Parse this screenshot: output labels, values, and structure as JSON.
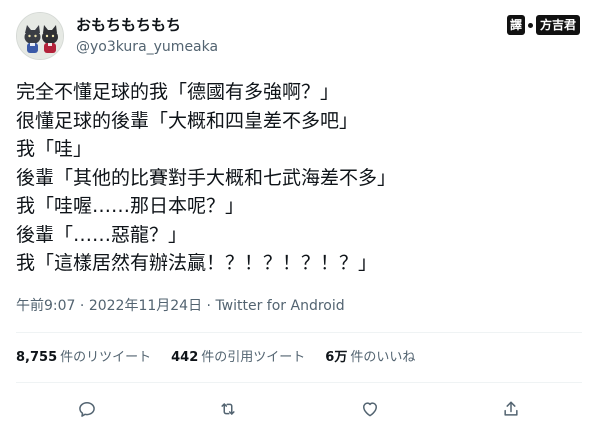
{
  "user": {
    "display_name": "おもちもちもち",
    "handle": "@yo3kura_yumeaka",
    "avatar_icon": "cat-avatar-icon"
  },
  "translator": {
    "label": "譯",
    "name": "方吉君"
  },
  "tweet": {
    "lines": [
      "完全不懂足球的我「德國有多強啊？」",
      "很懂足球的後輩「大概和四皇差不多吧」",
      "我「哇」",
      "後輩「其他的比賽對手大概和七武海差不多」",
      "我「哇喔……那日本呢？」",
      "後輩「……惡龍？」",
      "我「這樣居然有辦法贏！？！？！？！？」"
    ],
    "time": "午前9:07",
    "date": "2022年11月24日",
    "separator": "·",
    "source": "Twitter for Android"
  },
  "stats": {
    "retweets": {
      "count": "8,755",
      "label": "件のリツイート"
    },
    "quotes": {
      "count": "442",
      "label": "件の引用ツイート"
    },
    "likes": {
      "count": "6万",
      "label": "件のいいね"
    }
  },
  "actions": [
    {
      "name": "reply-icon"
    },
    {
      "name": "retweet-icon"
    },
    {
      "name": "like-icon"
    },
    {
      "name": "share-icon"
    }
  ],
  "colors": {
    "text": "#0f1419",
    "secondary": "#536471",
    "divider": "#eff3f4"
  }
}
